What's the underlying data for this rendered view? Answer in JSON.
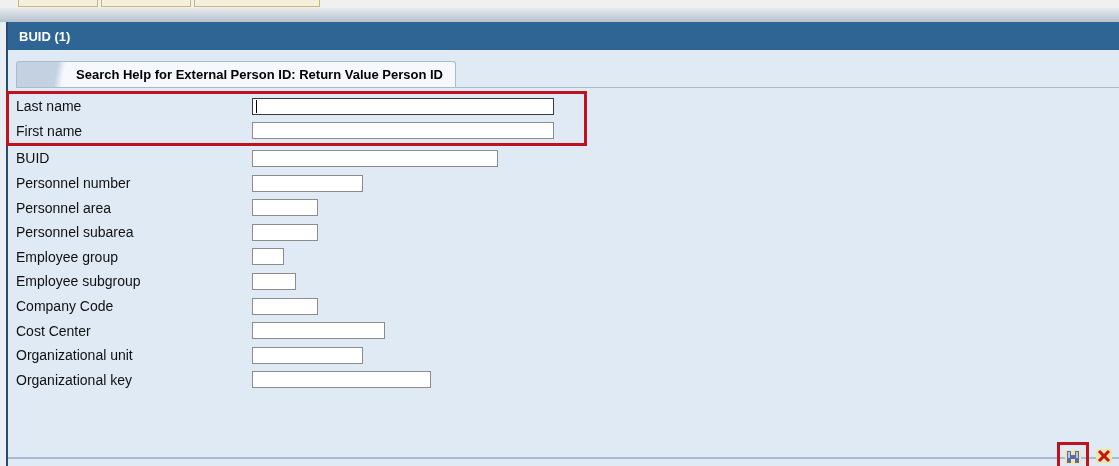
{
  "window": {
    "title": "BUID (1)"
  },
  "tabs": [
    {
      "label": "Search Help for External Person ID: Return Value Person ID",
      "selected": true
    }
  ],
  "fields": [
    {
      "label": "Last name",
      "focused": true,
      "highlighted": true
    },
    {
      "label": "First name",
      "focused": false,
      "highlighted": true
    },
    {
      "label": "BUID",
      "focused": false,
      "highlighted": false
    },
    {
      "label": "Personnel number",
      "focused": false,
      "highlighted": false
    },
    {
      "label": "Personnel area",
      "focused": false,
      "highlighted": false
    },
    {
      "label": "Personnel subarea",
      "focused": false,
      "highlighted": false
    },
    {
      "label": "Employee group",
      "focused": false,
      "highlighted": false
    },
    {
      "label": "Employee subgroup",
      "focused": false,
      "highlighted": false
    },
    {
      "label": "Company Code",
      "focused": false,
      "highlighted": false
    },
    {
      "label": "Cost Center",
      "focused": false,
      "highlighted": false
    },
    {
      "label": "Organizational unit",
      "focused": false,
      "highlighted": false
    },
    {
      "label": "Organizational key",
      "focused": false,
      "highlighted": false
    }
  ],
  "buttons": [
    {
      "kind": "search",
      "highlighted": true
    },
    {
      "kind": "cancel",
      "highlighted": false
    }
  ]
}
